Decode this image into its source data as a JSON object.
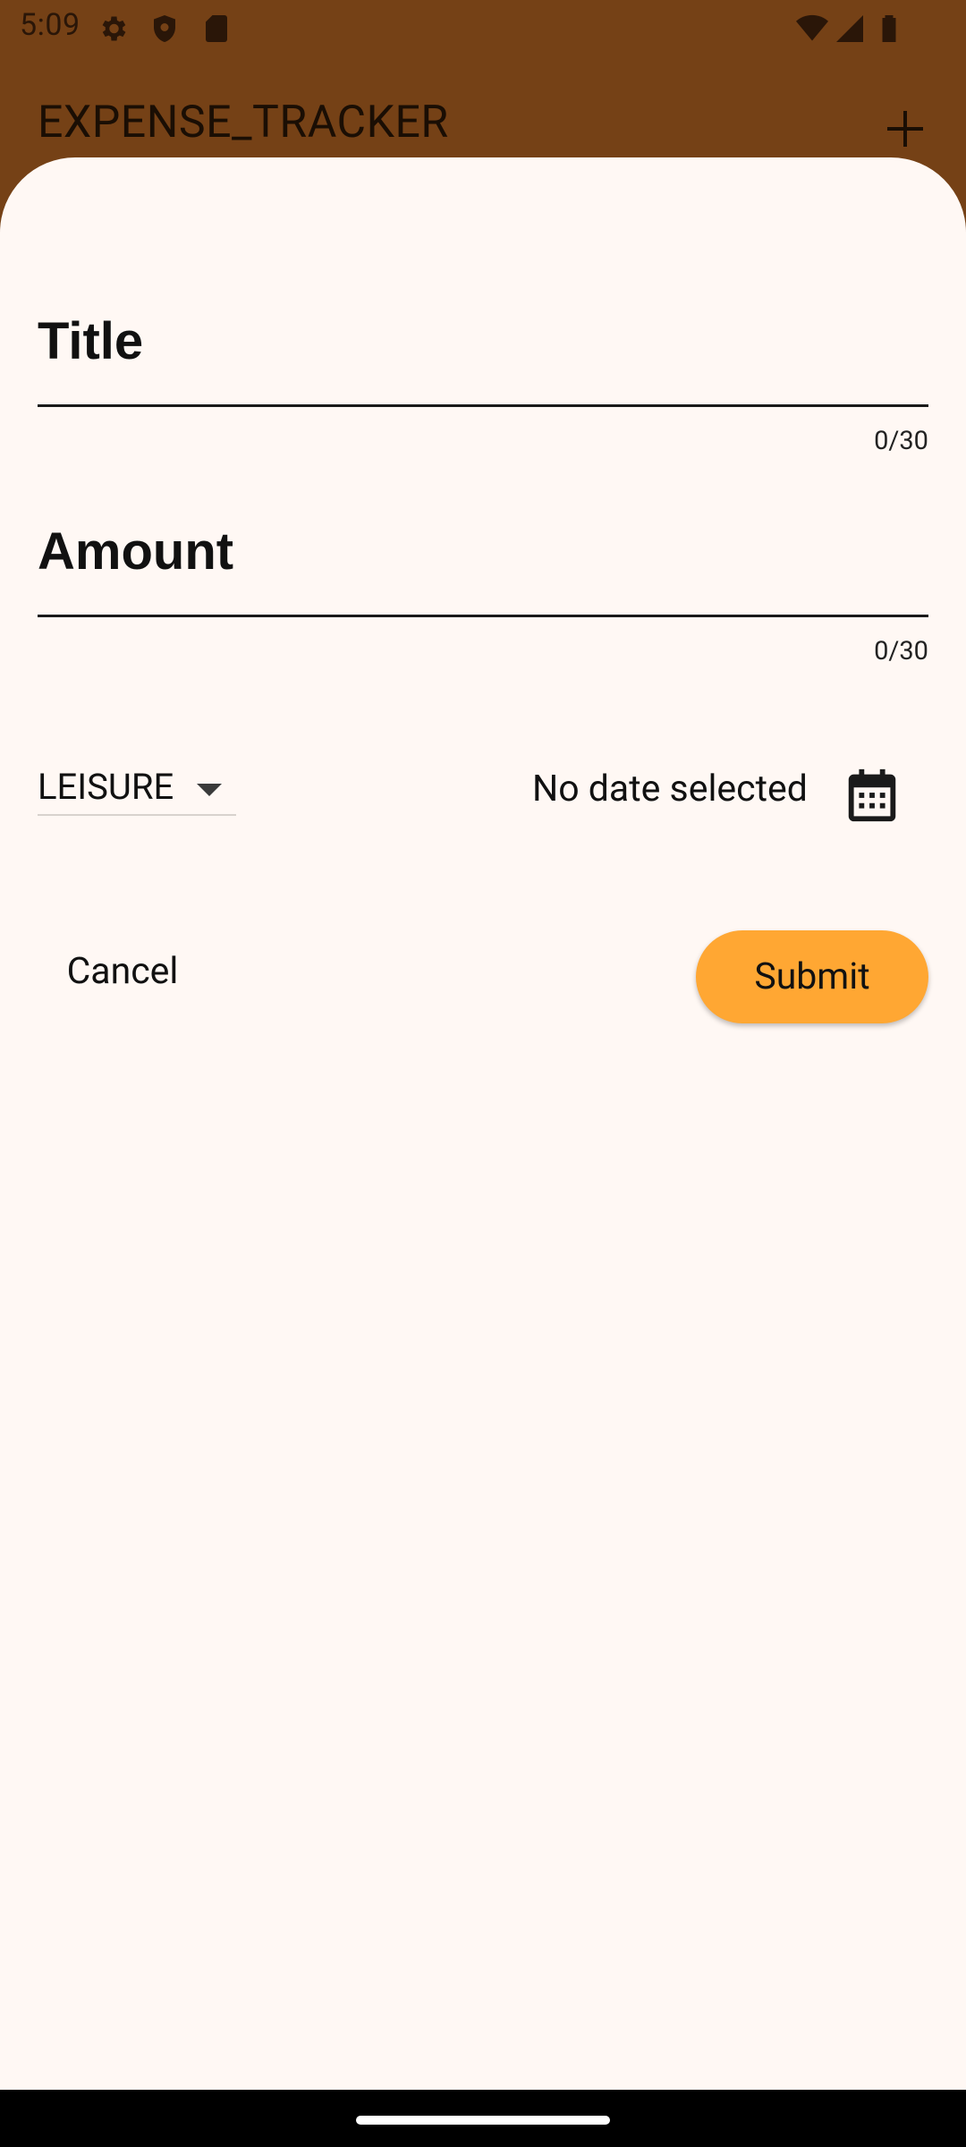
{
  "status_bar": {
    "time": "5:09",
    "icons": [
      "gear-icon",
      "shield-icon",
      "sd-card-icon",
      "wifi-icon",
      "signal-icon",
      "battery-icon"
    ]
  },
  "app_bar": {
    "title": "EXPENSE_TRACKER",
    "add_icon": "plus-icon"
  },
  "form": {
    "title_field": {
      "label": "Title",
      "value": "",
      "counter": "0/30"
    },
    "amount_field": {
      "label": "Amount",
      "value": "",
      "counter": "0/30"
    },
    "category": {
      "selected": "LEISURE"
    },
    "date": {
      "text": "No date selected",
      "icon": "calendar-icon"
    },
    "actions": {
      "cancel_label": "Cancel",
      "submit_label": "Submit"
    }
  },
  "colors": {
    "background_scrim": "#754116",
    "sheet": "#fff8f4",
    "submit": "#ffa733"
  }
}
